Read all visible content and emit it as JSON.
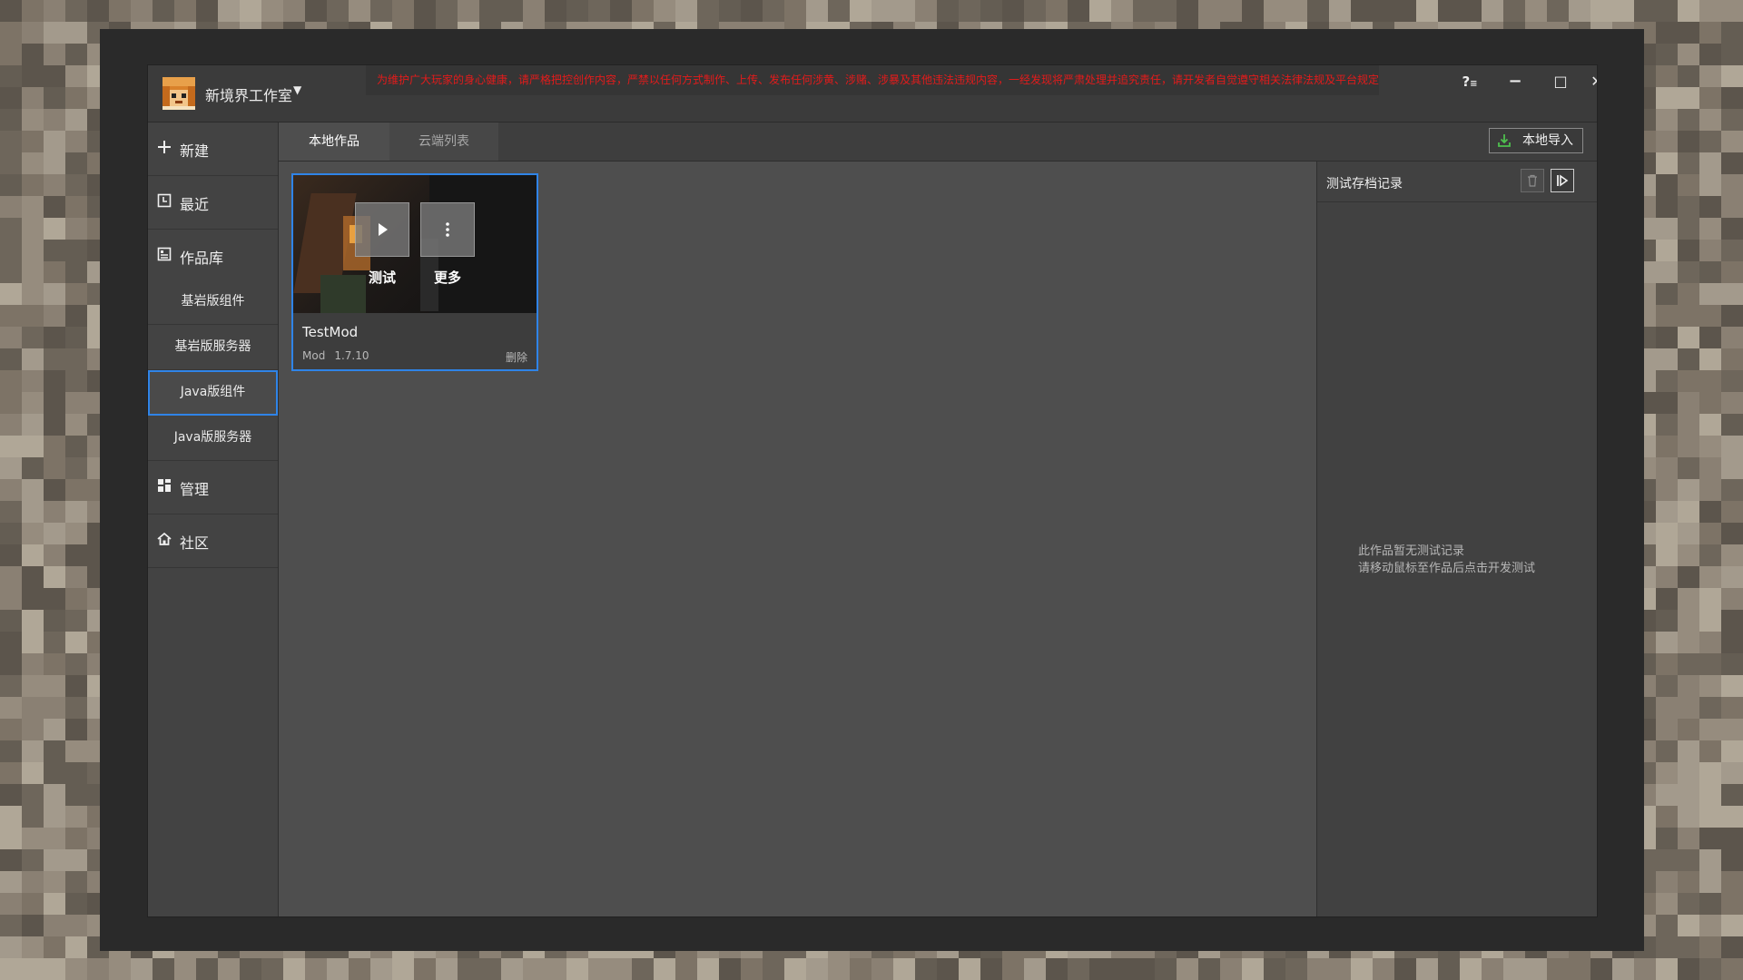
{
  "app": {
    "studio_name": "新境界工作室",
    "studio_caret": "▼",
    "notice": "为维护广大玩家的身心健康，请严格把控创作内容，严禁以任何方式制作、上传、发布任何涉黄、涉赌、涉暴及其他违法违规内容，一经发现将严肃处理并追究责任，请开发者自觉遵守相关法律法规及平台规定。",
    "window_controls": {
      "help_label": "?",
      "minimize_label": "−",
      "maximize_label": "□",
      "close_label": "✕"
    }
  },
  "sidebar": {
    "new_label": "新建",
    "recent_label": "最近",
    "library_label": "作品库",
    "sub_items": [
      "基岩版组件",
      "基岩版服务器",
      "Java版组件",
      "Java版服务器"
    ],
    "active_sub_item": "Java版组件",
    "manage_label": "管理",
    "community_label": "社区",
    "icons": [
      "plus-icon",
      "clock-icon",
      "library-icon",
      "dashboard-icon",
      "home-icon"
    ]
  },
  "tabs": {
    "local": "本地作品",
    "cloud": "云端列表",
    "active": "本地作品",
    "import_label": "本地导入",
    "import_icon": "download-icon",
    "import_icon_color": "#4ec04e"
  },
  "card": {
    "title": "TestMod",
    "type": "Mod",
    "version": "1.7.10",
    "delete_label": "删除",
    "test_label": "测试",
    "more_label": "更多",
    "border_color": "#2f84e8"
  },
  "right_panel": {
    "title": "测试存档记录",
    "empty_line1": "此作品暂无测试记录",
    "empty_line2": "请移动鼠标至作品后点击开发测试",
    "collapse_label": "|▷",
    "trash_label": "🗑"
  },
  "colors": {
    "accent": "#2f84e8",
    "notice_text": "#e31b1b",
    "window_bg": "#4e4e4e"
  }
}
